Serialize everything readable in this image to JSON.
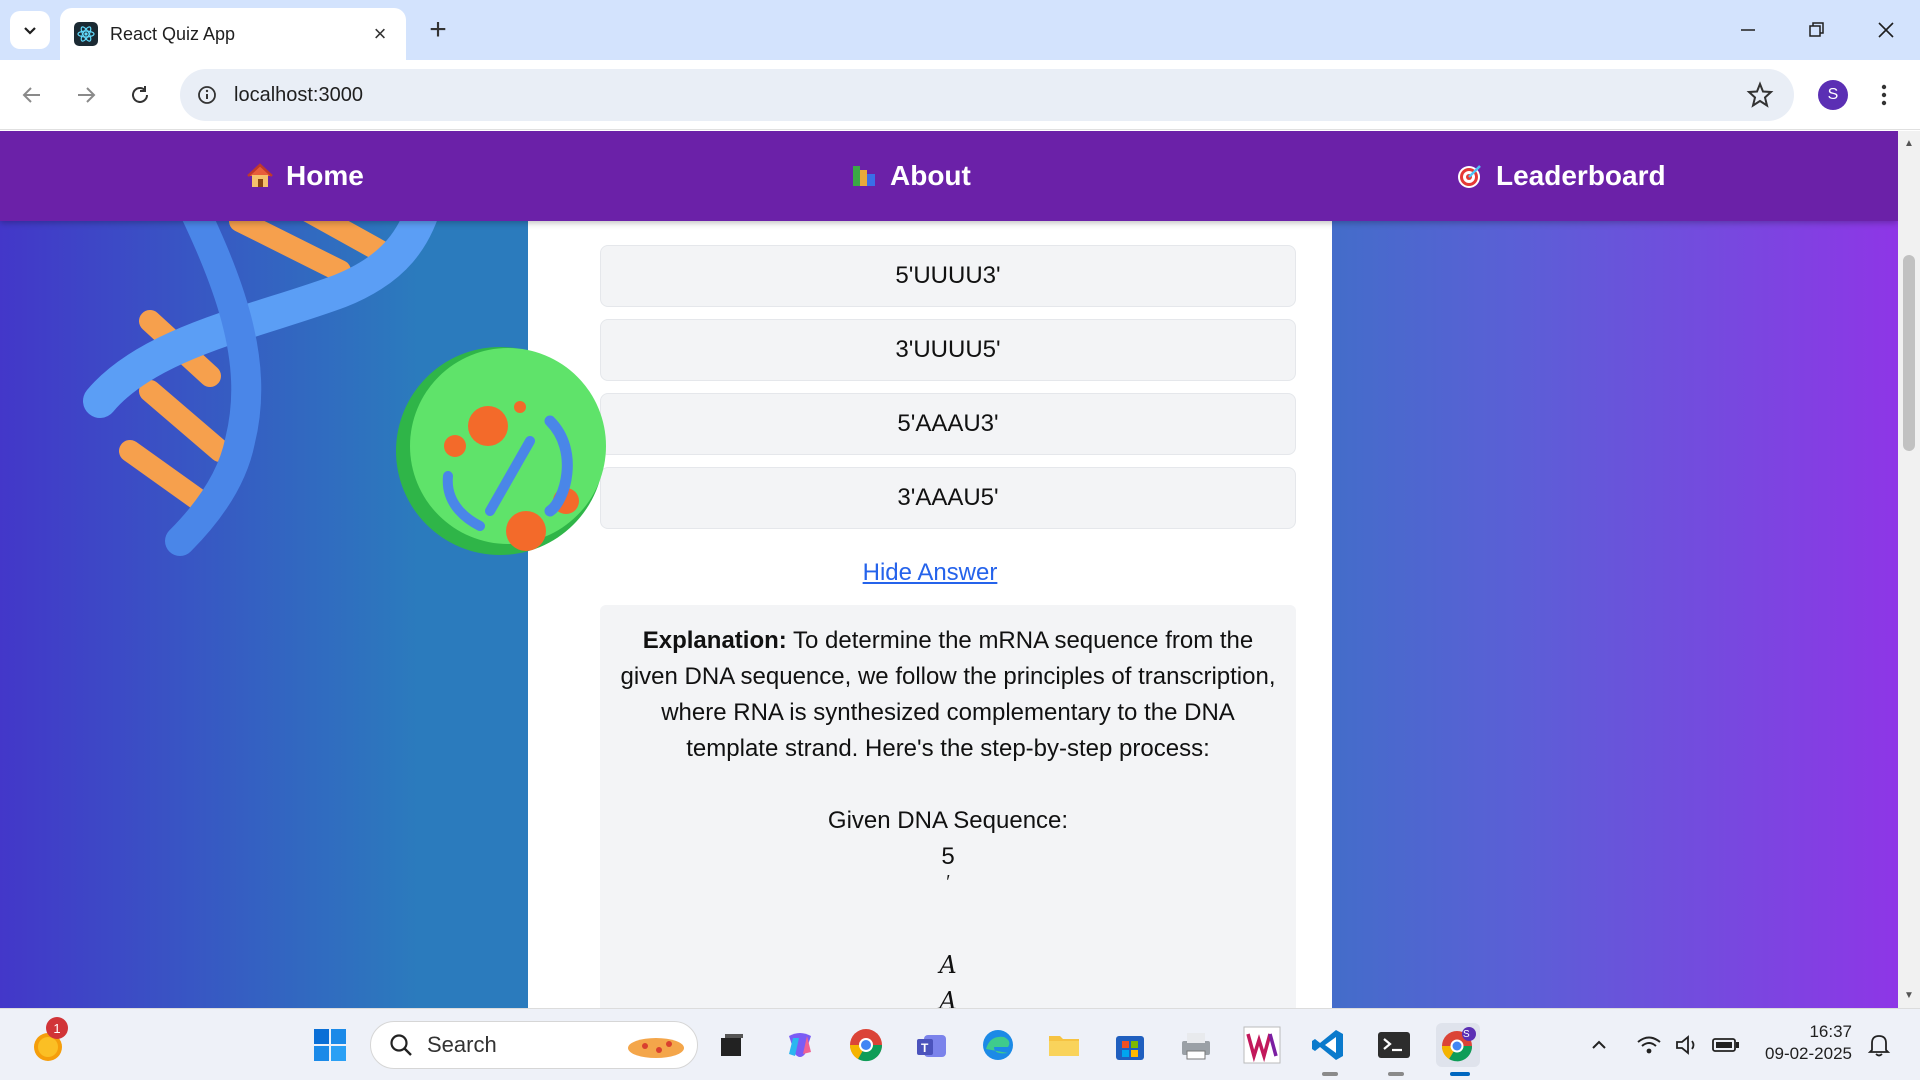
{
  "browser": {
    "tab_title": "React Quiz App",
    "url": "localhost:3000",
    "profile_initial": "S"
  },
  "navbar": {
    "items": [
      {
        "label": "Home",
        "icon": "house-icon"
      },
      {
        "label": "About",
        "icon": "books-icon"
      },
      {
        "label": "Leaderboard",
        "icon": "target-icon"
      }
    ]
  },
  "quiz": {
    "options": [
      "5'UUUU3'",
      "3'UUUU5'",
      "5'AAAU3'",
      "3'AAAU5'"
    ],
    "hide_answer_label": "Hide Answer",
    "explanation": {
      "label": "Explanation:",
      "text": "To determine the mRNA sequence from the given DNA sequence, we follow the principles of transcription, where RNA is synthesized complementary to the DNA template strand. Here's the step-by-step process:",
      "given_label": "Given DNA Sequence:",
      "math_lines": [
        "5",
        "′",
        "A",
        "A"
      ]
    }
  },
  "taskbar": {
    "search_placeholder": "Search",
    "time": "16:37",
    "date": "09-02-2025",
    "notification_count": "1",
    "chrome_profile_initial": "S"
  },
  "colors": {
    "navbar": "#6b21a8",
    "link": "#2563eb",
    "option_bg": "#f3f4f6"
  }
}
